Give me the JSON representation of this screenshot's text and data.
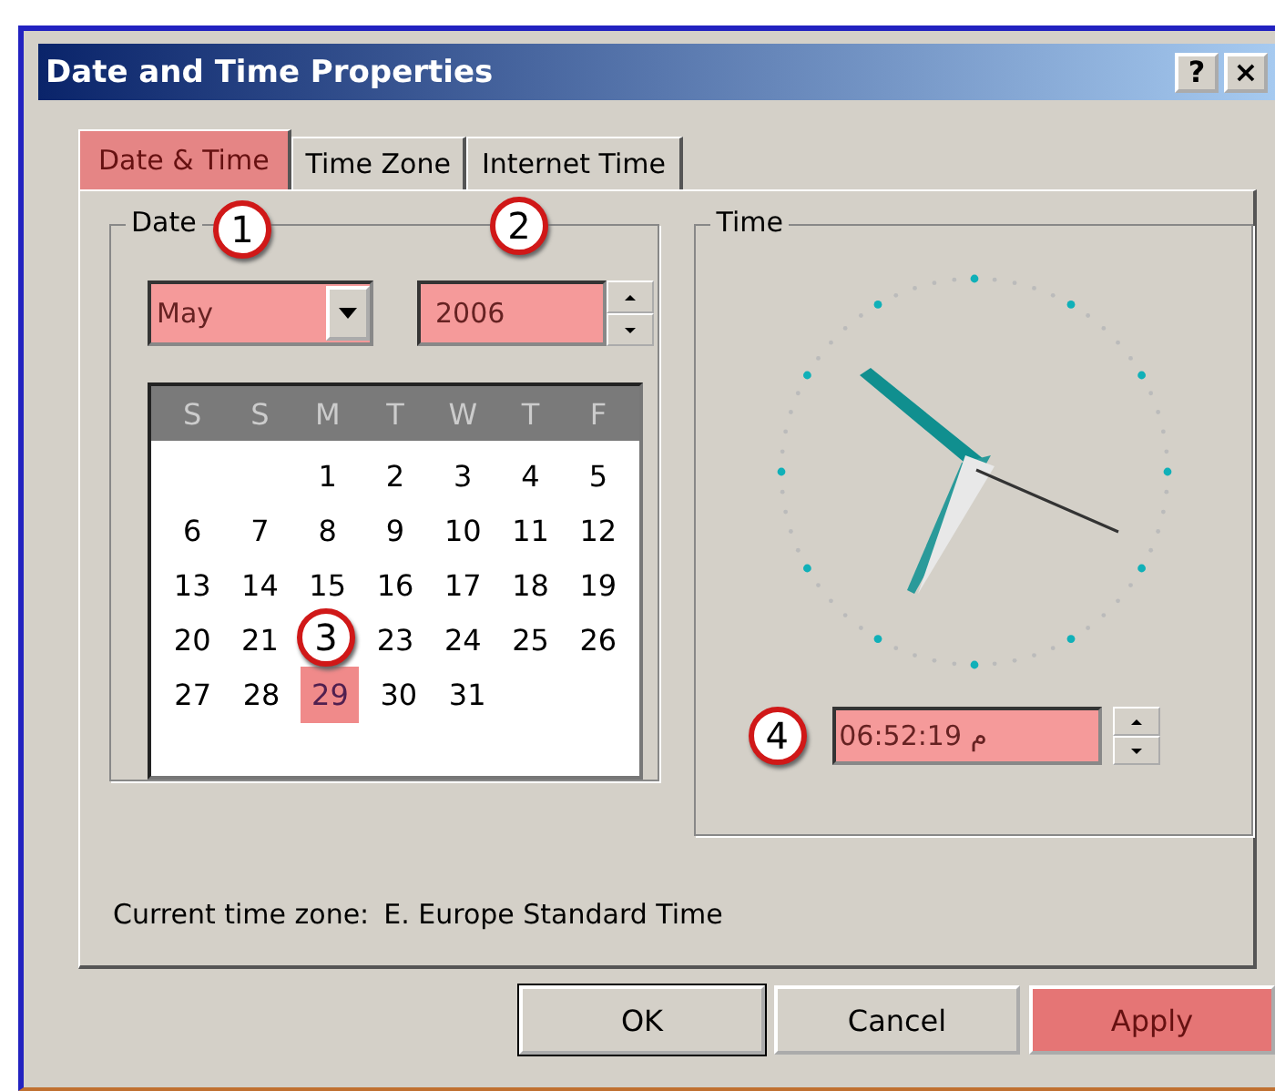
{
  "window": {
    "title": "Date and Time Properties",
    "help_button": "?",
    "close_button": "×"
  },
  "tabs": [
    {
      "label": "Date & Time",
      "selected": true,
      "highlighted": true
    },
    {
      "label": "Time Zone",
      "selected": false,
      "highlighted": false
    },
    {
      "label": "Internet Time",
      "selected": false,
      "highlighted": false
    }
  ],
  "date_group": {
    "title": "Date",
    "month": {
      "value": "May",
      "highlighted": true,
      "callout": "1"
    },
    "year": {
      "value": "2006",
      "highlighted": true,
      "callout": "2"
    },
    "calendar": {
      "weekdays": [
        "S",
        "S",
        "M",
        "T",
        "W",
        "T",
        "F"
      ],
      "callout": "3",
      "weeks": [
        [
          {
            "kind": "empty"
          },
          {
            "kind": "empty"
          },
          {
            "kind": "day",
            "day": "1",
            "selected": false
          },
          {
            "kind": "day",
            "day": "2",
            "selected": false
          },
          {
            "kind": "day",
            "day": "3",
            "selected": false
          },
          {
            "kind": "day",
            "day": "4",
            "selected": false
          },
          {
            "kind": "day",
            "day": "5",
            "selected": false
          }
        ],
        [
          {
            "kind": "day",
            "day": "6",
            "selected": false
          },
          {
            "kind": "day",
            "day": "7",
            "selected": false
          },
          {
            "kind": "day",
            "day": "8",
            "selected": false
          },
          {
            "kind": "day",
            "day": "9",
            "selected": false
          },
          {
            "kind": "day",
            "day": "10",
            "selected": false
          },
          {
            "kind": "day",
            "day": "11",
            "selected": false
          },
          {
            "kind": "day",
            "day": "12",
            "selected": false
          }
        ],
        [
          {
            "kind": "day",
            "day": "13",
            "selected": false
          },
          {
            "kind": "day",
            "day": "14",
            "selected": false
          },
          {
            "kind": "day",
            "day": "15",
            "selected": false
          },
          {
            "kind": "day",
            "day": "16",
            "selected": false
          },
          {
            "kind": "day",
            "day": "17",
            "selected": false
          },
          {
            "kind": "day",
            "day": "18",
            "selected": false
          },
          {
            "kind": "day",
            "day": "19",
            "selected": false
          }
        ],
        [
          {
            "kind": "day",
            "day": "20",
            "selected": false
          },
          {
            "kind": "day",
            "day": "21",
            "selected": false
          },
          {
            "kind": "empty"
          },
          {
            "kind": "day",
            "day": "23",
            "selected": false
          },
          {
            "kind": "day",
            "day": "24",
            "selected": false
          },
          {
            "kind": "day",
            "day": "25",
            "selected": false
          },
          {
            "kind": "day",
            "day": "26",
            "selected": false
          }
        ],
        [
          {
            "kind": "day",
            "day": "27",
            "selected": false
          },
          {
            "kind": "day",
            "day": "28",
            "selected": false
          },
          {
            "kind": "day",
            "day": "29",
            "selected": true
          },
          {
            "kind": "day",
            "day": "30",
            "selected": false
          },
          {
            "kind": "day",
            "day": "31",
            "selected": false
          }
        ]
      ]
    }
  },
  "time_group": {
    "title": "Time",
    "time": {
      "value": "06:52:19 م",
      "highlighted": true,
      "callout": "4"
    }
  },
  "current_time_zone": {
    "label": "Current time zone:",
    "value": "E. Europe Standard Time"
  },
  "buttons": [
    {
      "label": "OK",
      "default": true,
      "highlighted": false
    },
    {
      "label": "Cancel",
      "default": false,
      "highlighted": false
    },
    {
      "label": "Apply",
      "default": false,
      "highlighted": true
    }
  ]
}
